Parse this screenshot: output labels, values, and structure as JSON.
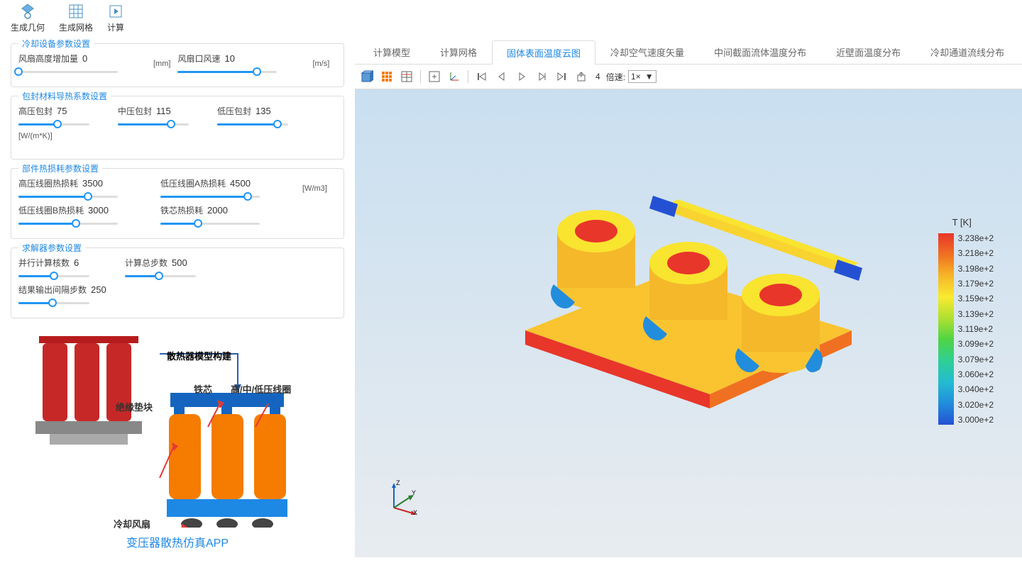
{
  "toolbar": {
    "generate_geometry": "生成几何",
    "generate_mesh": "生成网格",
    "compute": "计算"
  },
  "sections": {
    "cooling": {
      "title": "冷却设备参数设置",
      "fan_height_incr_label": "风扇高度增加量",
      "fan_height_incr_value": "0",
      "fan_height_unit": "[mm]",
      "fan_outlet_speed_label": "风扇口风速",
      "fan_outlet_speed_value": "10",
      "fan_outlet_unit": "[m/s]"
    },
    "thermal_cond": {
      "title": "包封材料导热系数设置",
      "hv_label": "高压包封",
      "hv_value": "75",
      "mv_label": "中压包封",
      "mv_value": "115",
      "lv_label": "低压包封",
      "lv_value": "135",
      "unit": "[W/(m*K)]"
    },
    "heat_loss": {
      "title": "部件热损耗参数设置",
      "hv_coil_label": "高压线圈热损耗",
      "hv_coil_value": "3500",
      "lv_coil_a_label": "低压线圈A热损耗",
      "lv_coil_a_value": "4500",
      "lv_coil_b_label": "低压线圈B热损耗",
      "lv_coil_b_value": "3000",
      "core_label": "铁芯热损耗",
      "core_value": "2000",
      "unit": "[W/m3]"
    },
    "solver": {
      "title": "求解器参数设置",
      "cores_label": "并行计算核数",
      "cores_value": "6",
      "total_steps_label": "计算总步数",
      "total_steps_value": "500",
      "output_interval_label": "结果输出间隔步数",
      "output_interval_value": "250"
    }
  },
  "diagram": {
    "model_build": "散热器模型构建",
    "insulation": "绝缘垫块",
    "core": "铁芯",
    "coils": "高/中/低压线圈",
    "fan": "冷却风扇",
    "app_title": "变压器散热仿真APP"
  },
  "tabs": [
    "计算模型",
    "计算网格",
    "固体表面温度云图",
    "冷却空气速度矢量",
    "中间截面流体温度分布",
    "近壁面温度分布",
    "冷却通道流线分布"
  ],
  "active_tab_index": 2,
  "viz_toolbar": {
    "frame_number": "4",
    "speed_label": "倍速:",
    "speed_value": "1×"
  },
  "legend": {
    "title": "T [K]",
    "values": [
      "3.238e+2",
      "3.218e+2",
      "3.198e+2",
      "3.179e+2",
      "3.159e+2",
      "3.139e+2",
      "3.119e+2",
      "3.099e+2",
      "3.079e+2",
      "3.060e+2",
      "3.040e+2",
      "3.020e+2",
      "3.000e+2"
    ]
  },
  "axis": {
    "x": "X",
    "y": "Y",
    "z": "Z"
  },
  "chart_data": {
    "type": "colormap_legend",
    "title": "T [K]",
    "x": [
      0,
      1,
      2,
      3,
      4,
      5,
      6,
      7,
      8,
      9,
      10,
      11,
      12
    ],
    "values": [
      323.8,
      321.8,
      319.8,
      317.9,
      315.9,
      313.9,
      311.9,
      309.9,
      307.9,
      306.0,
      304.0,
      302.0,
      300.0
    ],
    "ylim": [
      300.0,
      323.8
    ],
    "colormap": "jet_reversed"
  }
}
